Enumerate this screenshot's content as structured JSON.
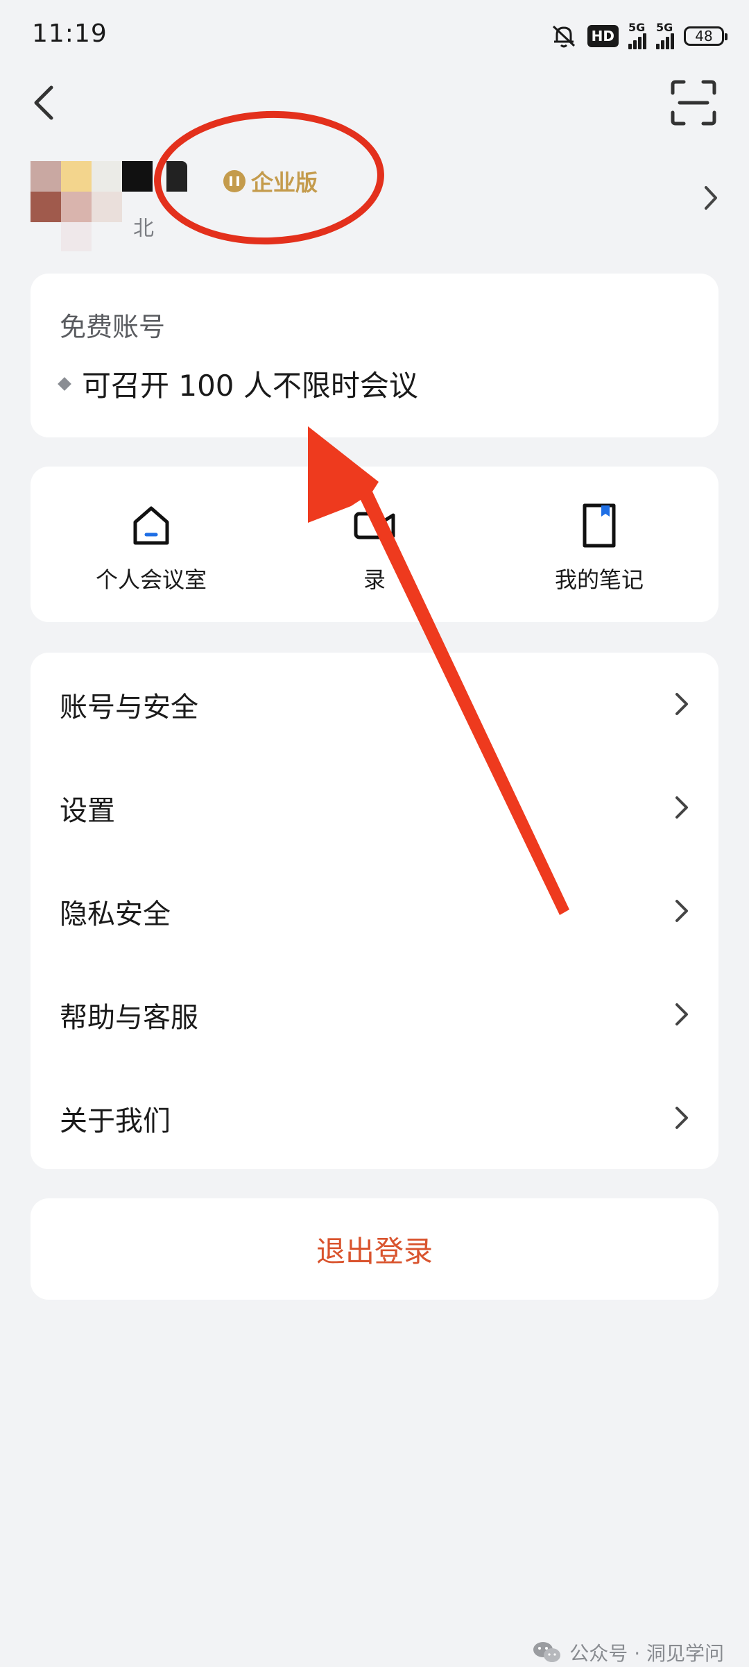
{
  "status_bar": {
    "time": "11:19",
    "hd_label": "HD",
    "network_1": "5G",
    "network_2": "5G",
    "battery": "48"
  },
  "profile": {
    "region": "北",
    "badge_label": "企业版",
    "badge_color": "#c49b4c"
  },
  "plan": {
    "title": "免费账号",
    "feature": "可召开 100 人不限时会议"
  },
  "quick_actions": [
    {
      "label": "个人会议室",
      "icon": "home-icon"
    },
    {
      "label": "录",
      "icon": "video-camera-icon"
    },
    {
      "label": "我的笔记",
      "icon": "notebook-icon"
    }
  ],
  "menu": [
    {
      "label": "账号与安全"
    },
    {
      "label": "设置"
    },
    {
      "label": "隐私安全"
    },
    {
      "label": "帮助与客服"
    },
    {
      "label": "关于我们"
    }
  ],
  "logout": {
    "label": "退出登录",
    "color": "#d9542e"
  },
  "watermark": {
    "text": "公众号 · 洞见学问"
  },
  "annotation_color": "#e3301c"
}
